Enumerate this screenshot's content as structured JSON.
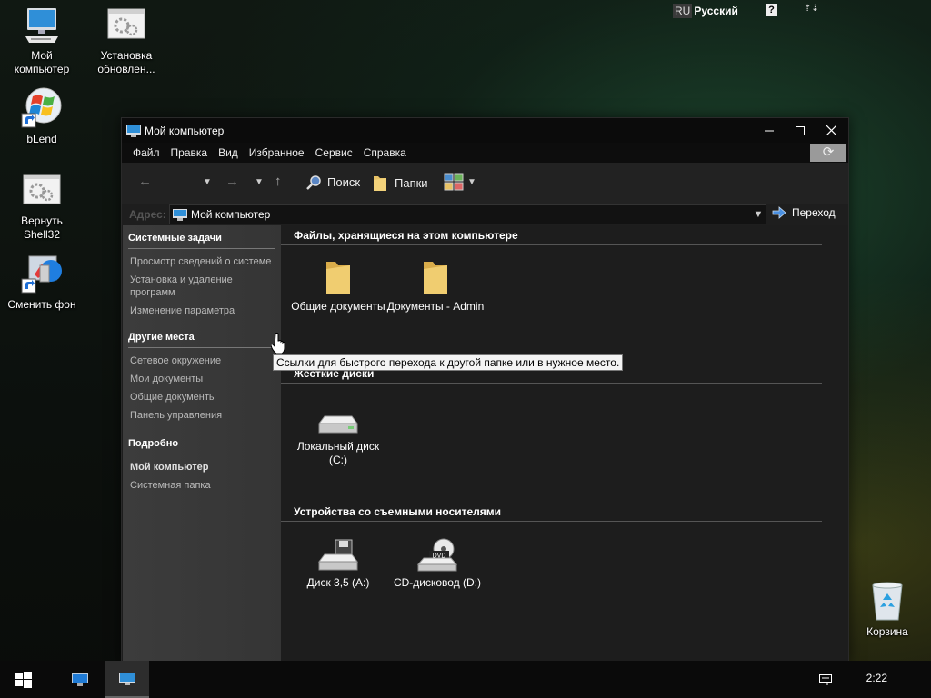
{
  "desktop": {
    "icons": [
      {
        "label": "Мой компьютер",
        "icon": "computer-icon"
      },
      {
        "label": "Установка обновлен...",
        "icon": "installer-icon"
      },
      {
        "label": "bLend",
        "icon": "windows-logo-shortcut-icon"
      },
      {
        "label": "Вернуть Shell32",
        "icon": "installer-icon"
      },
      {
        "label": "Сменить фон",
        "icon": "wallpaper-shortcut-icon"
      },
      {
        "label": "Корзина",
        "icon": "recycle-bin-icon"
      }
    ]
  },
  "language_bar": {
    "code": "RU",
    "language": "Русский",
    "help": "?",
    "options": "⇡⇣"
  },
  "window": {
    "title": "Мой компьютер",
    "menu": [
      "Файл",
      "Правка",
      "Вид",
      "Избранное",
      "Сервис",
      "Справка"
    ],
    "toolbar": {
      "back": "←",
      "forward": "→",
      "up": "↑",
      "search": "Поиск",
      "folders": "Папки"
    },
    "address": {
      "label": "Адрес:",
      "value": "Мой компьютер",
      "go": "Переход"
    },
    "sidebar": {
      "system_tasks": {
        "title": "Системные задачи",
        "links": [
          "Просмотр сведений о системе",
          "Установка и удаление программ",
          "Изменение параметра"
        ]
      },
      "other_places": {
        "title": "Другие места",
        "links": [
          "Сетевое окружение",
          "Мои документы",
          "Общие документы",
          "Панель управления"
        ]
      },
      "details": {
        "title": "Подробно",
        "name": "Мой компьютер",
        "type": "Системная папка"
      }
    },
    "groups": {
      "stored_files": {
        "title": "Файлы, хранящиеся на этом компьютере",
        "items": [
          "Общие документы",
          "Документы - Admin"
        ]
      },
      "hard_disks": {
        "title": "Жесткие диски",
        "items": [
          "Локальный диск (C:)"
        ]
      },
      "removable": {
        "title": "Устройства со съемными носителями",
        "items": [
          "Диск 3,5 (A:)",
          "CD-дисковод (D:)"
        ]
      }
    },
    "tooltip": "Ссылки для быстрого перехода к другой папке или в нужное место."
  },
  "taskbar": {
    "clock": "2:22"
  },
  "colors": {
    "window_bg": "#1d1d1d",
    "sidebar_bg": "#3a3a3a",
    "folder_yellow": "#e8c266",
    "monitor_blue": "#2f8fd8"
  }
}
